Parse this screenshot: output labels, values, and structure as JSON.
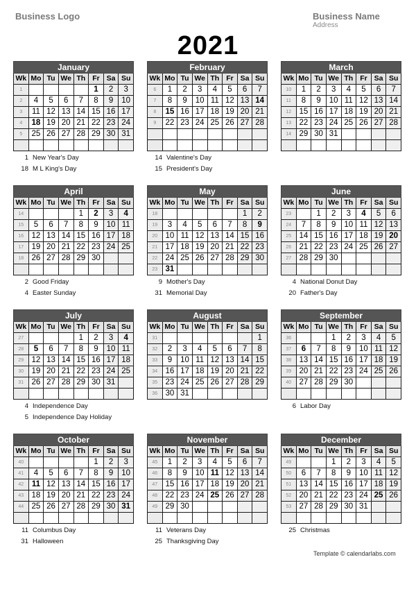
{
  "header": {
    "logo": "Business Logo",
    "business_name": "Business Name",
    "address": "Address",
    "year": "2021"
  },
  "weekday_headers": [
    "Wk",
    "Mo",
    "Tu",
    "We",
    "Th",
    "Fr",
    "Sa",
    "Su"
  ],
  "months": [
    {
      "name": "January",
      "weeks": [
        1,
        2,
        3,
        4,
        5
      ],
      "start": 4,
      "days": 31,
      "holidays": [
        {
          "day": "1",
          "name": "New Year's Day"
        },
        {
          "day": "18",
          "name": "M L King's Day"
        }
      ]
    },
    {
      "name": "February",
      "weeks": [
        6,
        7,
        8,
        9
      ],
      "start": 0,
      "days": 28,
      "holidays": [
        {
          "day": "14",
          "name": "Valentine's Day"
        },
        {
          "day": "15",
          "name": "President's Day"
        }
      ]
    },
    {
      "name": "March",
      "weeks": [
        10,
        11,
        12,
        13,
        14
      ],
      "start": 0,
      "days": 31,
      "holidays": []
    },
    {
      "name": "April",
      "weeks": [
        14,
        15,
        16,
        17,
        18
      ],
      "start": 3,
      "days": 30,
      "holidays": [
        {
          "day": "2",
          "name": "Good Friday"
        },
        {
          "day": "4",
          "name": "Easter Sunday"
        }
      ]
    },
    {
      "name": "May",
      "weeks": [
        18,
        19,
        20,
        21,
        22,
        23
      ],
      "start": 5,
      "days": 31,
      "holidays": [
        {
          "day": "9",
          "name": "Mother's Day"
        },
        {
          "day": "31",
          "name": "Memorial Day"
        }
      ]
    },
    {
      "name": "June",
      "weeks": [
        23,
        24,
        25,
        26,
        27
      ],
      "start": 1,
      "days": 30,
      "holidays": [
        {
          "day": "4",
          "name": "National Donut Day"
        },
        {
          "day": "20",
          "name": "Father's Day"
        }
      ]
    },
    {
      "name": "July",
      "weeks": [
        27,
        28,
        29,
        30,
        31
      ],
      "start": 3,
      "days": 31,
      "holidays": [
        {
          "day": "4",
          "name": "Independence Day"
        },
        {
          "day": "5",
          "name": "Independence Day Holiday"
        }
      ]
    },
    {
      "name": "August",
      "weeks": [
        31,
        32,
        33,
        34,
        35,
        36
      ],
      "start": 6,
      "days": 31,
      "holidays": []
    },
    {
      "name": "September",
      "weeks": [
        36,
        37,
        38,
        39,
        40
      ],
      "start": 2,
      "days": 30,
      "holidays": [
        {
          "day": "6",
          "name": "Labor Day"
        }
      ]
    },
    {
      "name": "October",
      "weeks": [
        40,
        41,
        42,
        43,
        44
      ],
      "start": 4,
      "days": 31,
      "holidays": [
        {
          "day": "11",
          "name": "Columbus Day"
        },
        {
          "day": "31",
          "name": "Halloween"
        }
      ]
    },
    {
      "name": "November",
      "weeks": [
        45,
        46,
        47,
        48,
        49
      ],
      "start": 0,
      "days": 30,
      "holidays": [
        {
          "day": "11",
          "name": "Veterans Day"
        },
        {
          "day": "25",
          "name": "Thanksgiving Day"
        }
      ]
    },
    {
      "name": "December",
      "weeks": [
        49,
        50,
        51,
        52,
        53
      ],
      "start": 2,
      "days": 31,
      "holidays": [
        {
          "day": "25",
          "name": "Christmas"
        }
      ]
    }
  ],
  "footer": "Template © calendarlabs.com"
}
